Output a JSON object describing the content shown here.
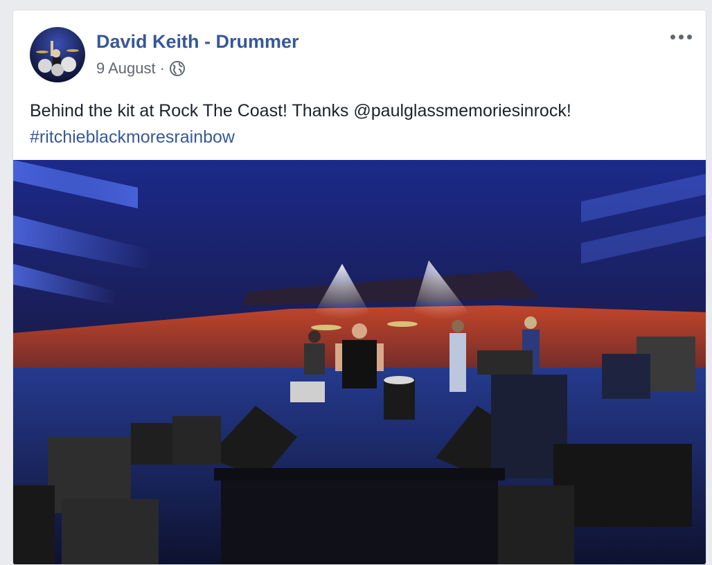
{
  "post": {
    "author": "David Keith - Drummer",
    "date": "9 August",
    "separator": "·",
    "text": "Behind the kit at Rock The Coast! Thanks @paulglassmemoriesinrock!",
    "hashtag": "#ritchieblackmoresrainbow"
  },
  "icons": {
    "privacy": "globe-icon",
    "options": "more-options-icon"
  },
  "colors": {
    "link": "#365899",
    "meta": "#616770",
    "text": "#1d2129",
    "page_background": "#e9ebee"
  }
}
